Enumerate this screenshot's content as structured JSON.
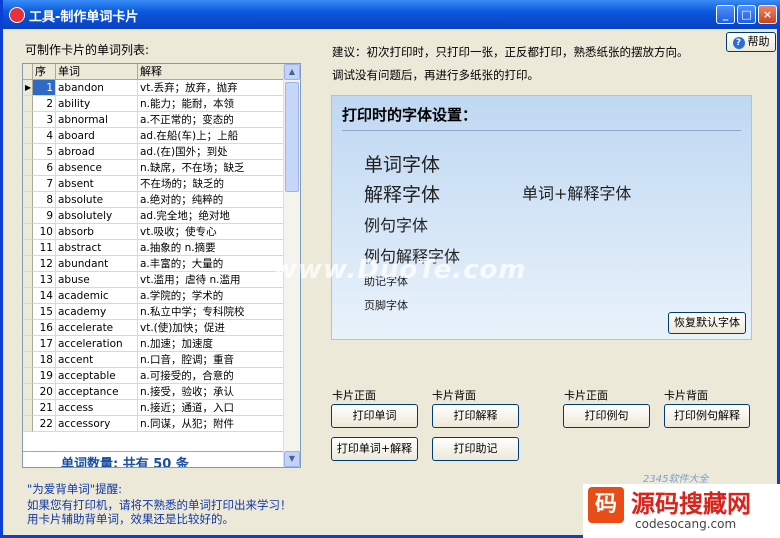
{
  "window": {
    "title": "工具-制作单词卡片",
    "help_label": "帮助",
    "help_glyph": "?"
  },
  "list_label": "可制作卡片的单词列表:",
  "grid": {
    "headers": [
      "序号",
      "单词",
      "解释"
    ],
    "selected_marker": "▶",
    "rows": [
      {
        "num": "1",
        "word": "abandon",
        "def": "vt.丢弃；放弃，抛弃"
      },
      {
        "num": "2",
        "word": "ability",
        "def": "n.能力；能耐，本领"
      },
      {
        "num": "3",
        "word": "abnormal",
        "def": "a.不正常的；变态的"
      },
      {
        "num": "4",
        "word": "aboard",
        "def": "ad.在船(车)上；上船"
      },
      {
        "num": "5",
        "word": "abroad",
        "def": "ad.(在)国外；到处"
      },
      {
        "num": "6",
        "word": "absence",
        "def": "n.缺席，不在场；缺乏"
      },
      {
        "num": "7",
        "word": "absent",
        "def": "不在场的；缺乏的"
      },
      {
        "num": "8",
        "word": "absolute",
        "def": "a.绝对的；纯粹的"
      },
      {
        "num": "9",
        "word": "absolutely",
        "def": "ad.完全地；绝对地"
      },
      {
        "num": "10",
        "word": "absorb",
        "def": "vt.吸收；使专心"
      },
      {
        "num": "11",
        "word": "abstract",
        "def": "a.抽象的 n.摘要"
      },
      {
        "num": "12",
        "word": "abundant",
        "def": "a.丰富的；大量的"
      },
      {
        "num": "13",
        "word": "abuse",
        "def": "vt.滥用；虐待 n.滥用"
      },
      {
        "num": "14",
        "word": "academic",
        "def": "a.学院的；学术的"
      },
      {
        "num": "15",
        "word": "academy",
        "def": "n.私立中学；专科院校"
      },
      {
        "num": "16",
        "word": "accelerate",
        "def": "vt.(使)加快；促进"
      },
      {
        "num": "17",
        "word": "acceleration",
        "def": "n.加速；加速度"
      },
      {
        "num": "18",
        "word": "accent",
        "def": "n.口音，腔调；重音"
      },
      {
        "num": "19",
        "word": "acceptable",
        "def": "a.可接受的，合意的"
      },
      {
        "num": "20",
        "word": "acceptance",
        "def": "n.接受，验收；承认"
      },
      {
        "num": "21",
        "word": "access",
        "def": "n.接近；通道，入口"
      },
      {
        "num": "22",
        "word": "accessory",
        "def": "n.同谋，从犯；附件"
      }
    ],
    "count_text": "单词数量:  共有  50  条"
  },
  "advice": {
    "line1": "建议：初次打印时，只打印一张，正反都打印，熟悉纸张的摆放方向。",
    "line2": "调试没有问题后，再进行多纸张的打印。"
  },
  "font_panel": {
    "title": "打印时的字体设置：",
    "word_font": "单词字体",
    "def_font": "解释字体",
    "word_def_font": "单词+解释字体",
    "example_font": "例句字体",
    "example_def_font": "例句解释字体",
    "mnemonic_font": "助记字体",
    "footer_font": "页脚字体",
    "reset_button": "恢复默认字体"
  },
  "print": {
    "group1_front": "卡片正面",
    "group1_back": "卡片背面",
    "group2_front": "卡片正面",
    "group2_back": "卡片背面",
    "print_word": "打印单词",
    "print_def": "打印解释",
    "print_example": "打印例句",
    "print_example_def": "打印例句解释",
    "print_word_def": "打印单词+解释",
    "print_mnemonic": "打印助记"
  },
  "tips": {
    "title": "\"为爱背单词\"提醒:",
    "line1": "如果您有打印机，请将不熟悉的单词打印出来学习！",
    "line2": "用卡片辅助背单词，效果还是比较好的。"
  },
  "overlays": {
    "watermark": "www.DuoTe.com",
    "brand_cn": "源码搜藏网",
    "brand_en": "codesocang.com",
    "brand_small": "2345软件大全",
    "brand_logo_glyph": "码"
  },
  "colors": {
    "title_bar": "#0a5ae0",
    "selection": "#316ac5",
    "tip_text": "#1036a8"
  }
}
